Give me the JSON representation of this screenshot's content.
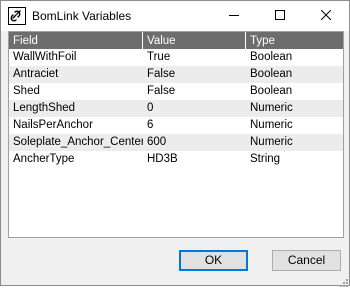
{
  "window": {
    "title": "BomLink Variables"
  },
  "grid": {
    "columns": [
      "Field",
      "Value",
      "Type"
    ],
    "rows": [
      {
        "field": "WallWithFoil",
        "value": "True",
        "type": "Boolean"
      },
      {
        "field": "Antraciet",
        "value": "False",
        "type": "Boolean"
      },
      {
        "field": "Shed",
        "value": "False",
        "type": "Boolean"
      },
      {
        "field": "LengthShed",
        "value": "0",
        "type": "Numeric"
      },
      {
        "field": "NailsPerAnchor",
        "value": "6",
        "type": "Numeric"
      },
      {
        "field": "Soleplate_Anchor_Centers",
        "value": "600",
        "type": "Numeric"
      },
      {
        "field": "AncherType",
        "value": "HD3B",
        "type": "String"
      }
    ]
  },
  "buttons": {
    "ok": "OK",
    "cancel": "Cancel"
  },
  "icons": {
    "app": "link-icon",
    "minimize": "minimize-icon",
    "maximize": "maximize-icon",
    "close": "close-icon"
  },
  "colors": {
    "header_bg": "#6d6d6d",
    "alt_row_bg": "#ececec",
    "default_button_border": "#0078d7"
  }
}
